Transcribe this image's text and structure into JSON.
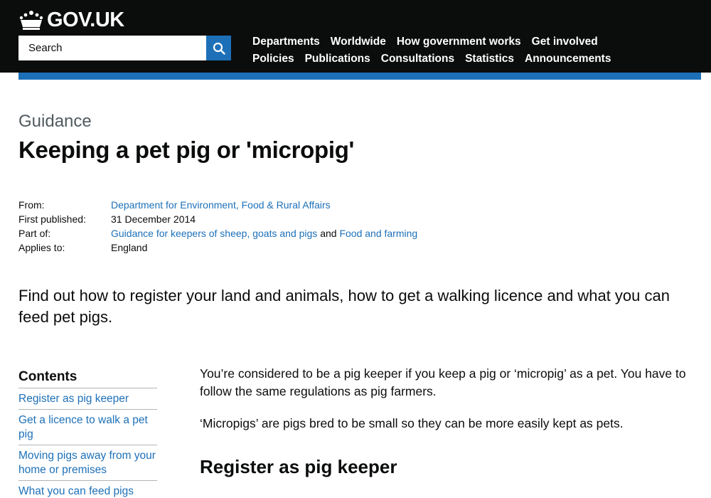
{
  "header": {
    "logo_text": "GOV.UK",
    "search_placeholder": "Search",
    "nav_row1": [
      "Departments",
      "Worldwide",
      "How government works",
      "Get involved"
    ],
    "nav_row2": [
      "Policies",
      "Publications",
      "Consultations",
      "Statistics",
      "Announcements"
    ]
  },
  "colors": {
    "header_bg": "#0b0c0c",
    "brand_blue": "#1d70b8",
    "link": "#1d70b8",
    "secondary_text": "#505a5f"
  },
  "page": {
    "context": "Guidance",
    "title": "Keeping a pet pig or 'micropig'"
  },
  "metadata": {
    "from_label": "From:",
    "from_value": "Department for Environment, Food & Rural Affairs",
    "published_label": "First published:",
    "published_value": "31 December 2014",
    "part_of_label": "Part of:",
    "part_of_link1": "Guidance for keepers of sheep, goats and pigs",
    "part_of_and": "and",
    "part_of_link2": "Food and farming",
    "applies_label": "Applies to:",
    "applies_value": "England"
  },
  "lead": "Find out how to register your land and animals, how to get a walking licence and what you can feed pet pigs.",
  "contents": {
    "heading": "Contents",
    "items": [
      "Register as pig keeper",
      "Get a licence to walk a pet pig",
      "Moving pigs away from your home or premises",
      "What you can feed pigs"
    ]
  },
  "body": {
    "para1": "You’re considered to be a pig keeper if you keep a pig or ‘micropig’ as a pet. You have to follow the same regulations as pig farmers.",
    "para2": "‘Micropigs’ are pigs bred to be small so they can be more easily kept as pets.",
    "heading1": "Register as pig keeper"
  },
  "icons": {
    "logo": "crown-icon",
    "search": "search-icon"
  }
}
